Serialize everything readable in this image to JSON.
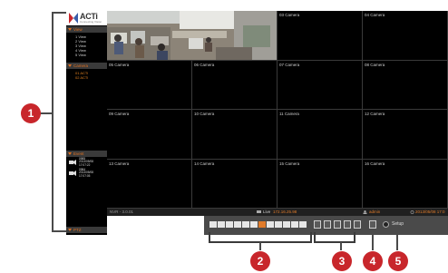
{
  "app": {
    "logo_text": "ACTi",
    "logo_sub": "Connecting Vision"
  },
  "sidebar": {
    "view_header": "View",
    "views": [
      "1 View",
      "2 View",
      "3 View",
      "4 View",
      "5 View"
    ],
    "camera_header": "Camera",
    "cameras": [
      "01 ACTi",
      "02 ACTi"
    ],
    "event_header": "Event",
    "events": [
      {
        "text": "0985\n2013/05/08\n17:07:22"
      },
      {
        "text": "0984\n2013/05/08\n17:07:05"
      }
    ],
    "ptz_header": "PTZ"
  },
  "grid": {
    "cells": [
      "",
      "",
      "03 Camera",
      "04 Camera",
      "05 Camera",
      "06 Camera",
      "07 Camera",
      "08 Camera",
      "09 Camera",
      "10 Camera",
      "11 Camera",
      "12 Camera",
      "13 Camera",
      "14 Camera",
      "15 Camera",
      "16 Camera"
    ]
  },
  "status": {
    "left": "NVR - 3.0.01",
    "live_label": "Live",
    "live_value": "172.16.25.98",
    "user": "admin",
    "datetime": "2013/05/08 17:0"
  },
  "toolbar": {
    "settings_label": "Setup",
    "accent": "#e07b2a"
  },
  "callouts": [
    "1",
    "2",
    "3",
    "4",
    "5"
  ],
  "colors": {
    "callout": "#c8262b",
    "panel_accent": "#e07020"
  }
}
